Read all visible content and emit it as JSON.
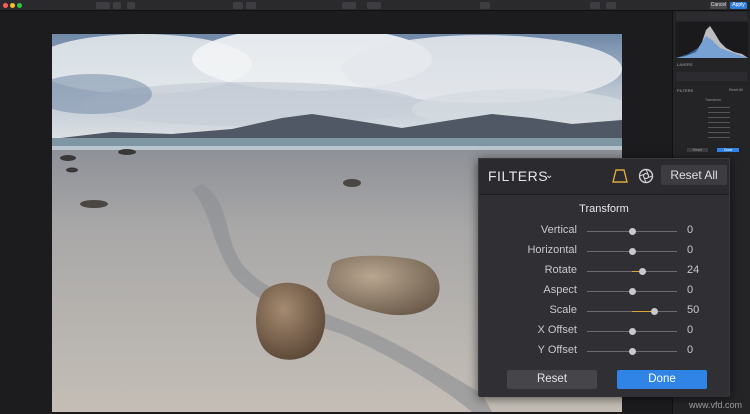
{
  "colors": {
    "accent_blue": "#2f84e6",
    "slider_fill": "#e0a63a",
    "panel_bg": "#2b2b2f"
  },
  "filters": {
    "title": "FILTERS",
    "reset_all_label": "Reset All",
    "section": "Transform",
    "sliders": [
      {
        "label": "Vertical",
        "value": "0",
        "position": 0.5
      },
      {
        "label": "Horizontal",
        "value": "0",
        "position": 0.5
      },
      {
        "label": "Rotate",
        "value": "24",
        "position": 0.62
      },
      {
        "label": "Aspect",
        "value": "0",
        "position": 0.5
      },
      {
        "label": "Scale",
        "value": "50",
        "position": 0.75
      },
      {
        "label": "X Offset",
        "value": "0",
        "position": 0.5
      },
      {
        "label": "Y Offset",
        "value": "0",
        "position": 0.5
      }
    ],
    "reset_label": "Reset",
    "done_label": "Done"
  },
  "sidepanel": {
    "layers_label": "LAYERS",
    "filters_label": "FILTERS",
    "reset_all_label": "Reset All",
    "section": "Transform",
    "reset_label": "Reset",
    "done_label": "Done"
  },
  "toolbar": {
    "cancel_label": "Cancel",
    "apply_label": "Apply"
  },
  "watermark": "www.vfd.com"
}
